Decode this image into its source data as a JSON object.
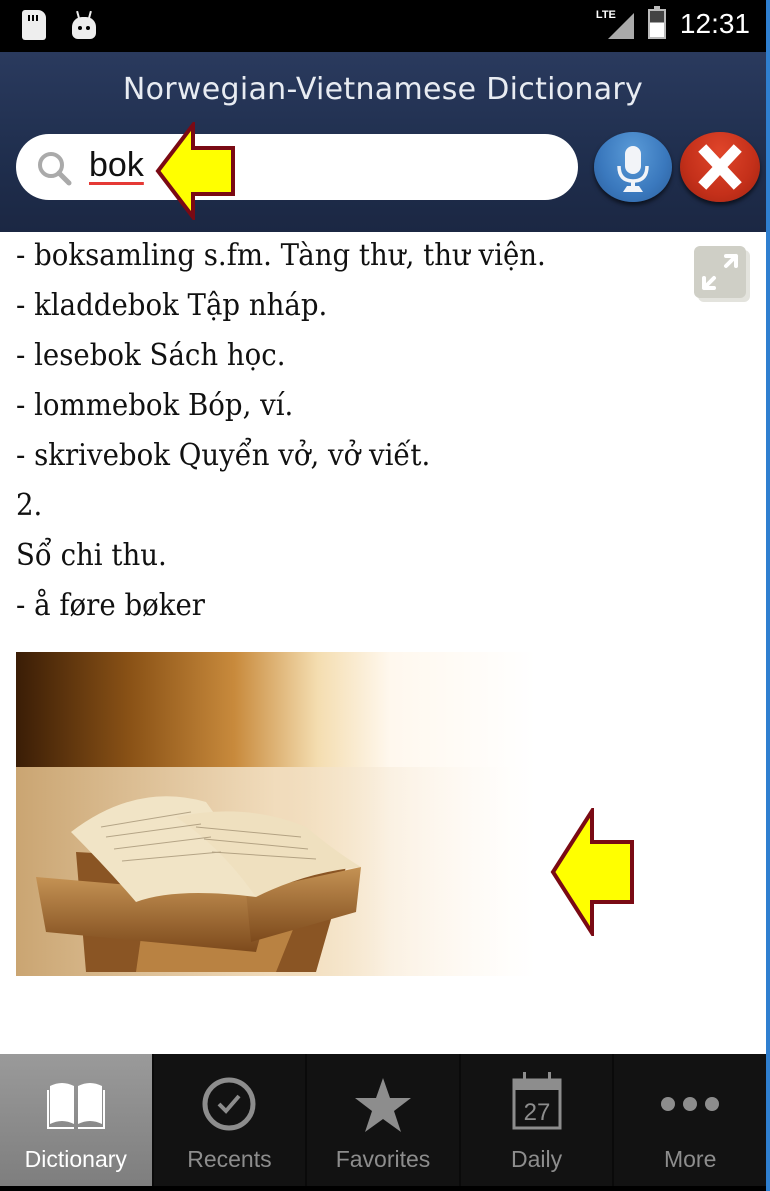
{
  "status_bar": {
    "time": "12:31",
    "network": "LTE",
    "left_icons": [
      "sd-card-icon",
      "android-debug-icon"
    ],
    "right_icons": [
      "lte-signal-icon",
      "battery-charging-icon"
    ]
  },
  "header": {
    "title": "Norwegian-Vietnamese Dictionary",
    "search": {
      "value": "bok",
      "placeholder": ""
    },
    "mic_button_label": "Voice search",
    "clear_button_label": "Clear search"
  },
  "entry": {
    "lines": [
      "- boksamling s.fm. Tàng thư, thư viện.",
      "- kladdebok Tập nháp.",
      "- lesebok Sách học.",
      "- lommebok Bóp, ví.",
      "- skrivebok Quyển vở, vở viết.",
      "2.",
      "Sổ chi thu.",
      "- å føre bøker"
    ],
    "image_alt": "Old open book"
  },
  "annotations": {
    "arrow_color": "#ffff00",
    "arrow_outline": "#7a0a14"
  },
  "bottom_nav": {
    "active": "Dictionary",
    "tabs": [
      {
        "label": "Dictionary",
        "icon": "book-icon"
      },
      {
        "label": "Recents",
        "icon": "check-circle-icon"
      },
      {
        "label": "Favorites",
        "icon": "star-icon"
      },
      {
        "label": "Daily",
        "icon": "calendar-icon",
        "calendar_day": "27"
      },
      {
        "label": "More",
        "icon": "more-dots-icon"
      }
    ]
  },
  "colors": {
    "header_bg": "#1f2e4d",
    "mic_blue": "#3a78bd",
    "clear_red": "#c4301a",
    "nav_bg": "#121212",
    "nav_active": "#8a8a8a"
  }
}
